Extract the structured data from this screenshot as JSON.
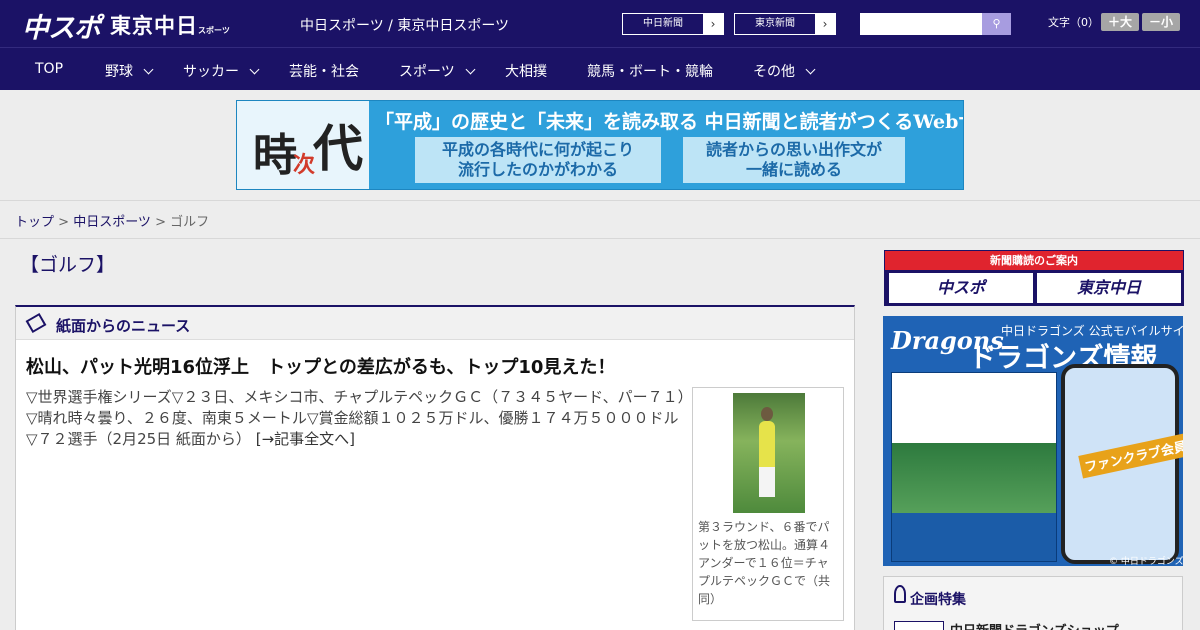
{
  "header": {
    "logo_chuspo": "中スポ",
    "logo_tokyo": "東京中日",
    "logo_tokyo_small": "スポーツ",
    "site_title": "中日スポーツ / 東京中日スポーツ",
    "pub_links": [
      "中日新聞",
      "東京新聞"
    ],
    "pub_arrow": "›",
    "search_placeholder": "",
    "search_icon": "🔍",
    "fontsize_label": "文字（0）",
    "font_larger": "＋大",
    "font_smaller": "－小"
  },
  "nav": {
    "items": [
      {
        "label": "TOP",
        "has_menu": false
      },
      {
        "label": "野球",
        "has_menu": true
      },
      {
        "label": "サッカー",
        "has_menu": true
      },
      {
        "label": "芸能・社会",
        "has_menu": false
      },
      {
        "label": "スポーツ",
        "has_menu": true
      },
      {
        "label": "大相撲",
        "has_menu": false
      },
      {
        "label": "競馬・ボート・競輪",
        "has_menu": false
      },
      {
        "label": "その他",
        "has_menu": true
      }
    ]
  },
  "banner": {
    "kanji_1": "時",
    "kanji_2": "次",
    "kanji_3": "代",
    "headline": "「平成」の歴史と「未来」を読み取る 中日新聞と読者がつくるWebサイト",
    "box1_line1": "平成の各時代に何が起こり",
    "box1_line2": "流行したのかがわかる",
    "box2_line1": "読者からの思い出作文が",
    "box2_line2": "一緒に読める"
  },
  "breadcrumb": {
    "top": "トップ",
    "sep": " > ",
    "section": "中日スポーツ",
    "current": "ゴルフ"
  },
  "main": {
    "page_heading": "【ゴルフ】",
    "panel_label": "紙面からのニュース",
    "article": {
      "title": "松山、パット光明16位浮上　トップとの差広がるも、トップ10見えた！",
      "body": "▽世界選手権シリーズ▽２３日、メキシコ市、チャプルテペックＧＣ（７３４５ヤード、パー７１）▽晴れ時々曇り、２６度、南東５メートル▽賞金総額１０２５万ドル、優勝１７４万５０００ドル▽７２選手（2月25日 紙面から）",
      "more": "[→記事全文へ]",
      "caption": "第３ラウンド、６番でパットを放つ松山。通算４アンダーで１６位＝チャプルテペックＧＣで（共同）"
    }
  },
  "sidebar": {
    "subscribe_head": "新聞購読のご案内",
    "subscribe_logo_1": "中スポ",
    "subscribe_logo_2": "東京中日",
    "ad_logo": "Dragons",
    "ad_line1": "中日ドラゴンズ 公式モバイルサイト",
    "ad_line2": "ドラゴンズ情報",
    "ad_badge": "ファンクラブ会員募集中",
    "ad_copy": "© 中日ドラゴンズ",
    "feature_label": "企画特集",
    "feature_link": "中日新聞ドラゴンズショップ"
  },
  "colors": {
    "brand_navy": "#1b1266",
    "accent_red": "#e0242e",
    "banner_blue": "#2ea0db"
  }
}
